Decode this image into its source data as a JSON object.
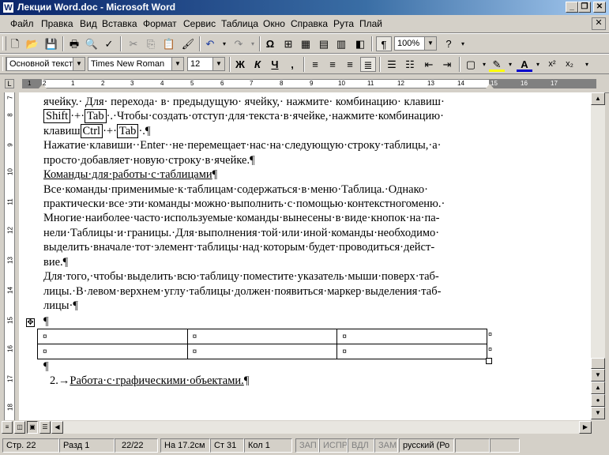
{
  "window": {
    "title": "Лекции Word.doc - Microsoft Word",
    "app_icon": "W"
  },
  "menu": [
    "Файл",
    "Правка",
    "Вид",
    "Вставка",
    "Формат",
    "Сервис",
    "Таблица",
    "Окно",
    "Справка",
    "Рута",
    "Плай"
  ],
  "toolbar_standard": {
    "zoom": "100%"
  },
  "toolbar_format": {
    "style": "Основной текст",
    "font": "Times New Roman",
    "size": "12",
    "bold": "Ж",
    "italic": "К",
    "underline": "Ч"
  },
  "ruler": {
    "marks": [
      "1",
      "2",
      "1",
      "1",
      "2",
      "3",
      "4",
      "5",
      "6",
      "7",
      "8",
      "9",
      "10",
      "11",
      "12",
      "13",
      "14",
      "15",
      "16",
      "17"
    ]
  },
  "vruler": {
    "marks": [
      "7",
      "8",
      "9",
      "10",
      "11",
      "12",
      "13",
      "14",
      "15",
      "16",
      "17",
      "18"
    ]
  },
  "document": {
    "lines": [
      {
        "text": "ячейку.· Для· перехода· в· предыдущую· ячейку,· нажмите· комбинацию· клавиш·"
      },
      {
        "k1": "Shift",
        "t1": "·+·",
        "k2": "Tab",
        "t2": "·.·Чтобы·создать·отступ·для·текста·в·ячейке,·нажмите·комбинацию·"
      },
      {
        "t0": "клавиш",
        "k1": "Ctrl",
        "t1": "·+·",
        "k2": "Tab",
        "t2": "·.¶"
      },
      {
        "text": "Нажатие·клавиши··Enter··не·перемещает·нас·на·следующую·строку·таблицы,·а·"
      },
      {
        "text": "просто·добавляет·новую·строку·в·ячейке.¶"
      },
      {
        "heading": "Команды·для·работы·с·таблицами",
        "tail": "¶"
      },
      {
        "text": "Все·команды·применимые·к·таблицам·содержаться·в·меню·Таблица.·Однако·"
      },
      {
        "text": "практически·все·эти·команды·можно·выполнить·с·помощью·контекстногоменю.·"
      },
      {
        "text": "Многие·наиболее·часто·используемые·команды·вынесены·в·виде·кнопок·на·па-"
      },
      {
        "text": "нели·Таблицы·и·границы.·Для·выполнения·той·или·иной·команды·необходимо·"
      },
      {
        "text": "выделить·вначале·тот·элемент·таблицы·над·которым·будет·проводиться·дейст-"
      },
      {
        "text": "вие.¶"
      },
      {
        "text": "Для·того,·чтобы·выделить·всю·таблицу·поместите·указатель·мыши·поверх·таб-"
      },
      {
        "text": "лицы.·В·левом·верхнем·углу·таблицы·должен·появиться·маркер·выделения·таб-"
      },
      {
        "text": "лицы·¶"
      }
    ],
    "pilcrow": "¶",
    "cell_mark": "¤",
    "list_item": {
      "number": "2.",
      "arrow": "→",
      "text": "Работа·с·графическими·объектами.",
      "tail": "¶"
    }
  },
  "status": {
    "page": "Стр. 22",
    "section": "Разд 1",
    "pages": "22/22",
    "at": "На 17.2см",
    "line": "Ст 31",
    "col": "Кол 1",
    "rec": "ЗАП",
    "trk": "ИСПР",
    "ext": "ВДЛ",
    "ovr": "ЗАМ",
    "lang": "русский (Ро"
  }
}
